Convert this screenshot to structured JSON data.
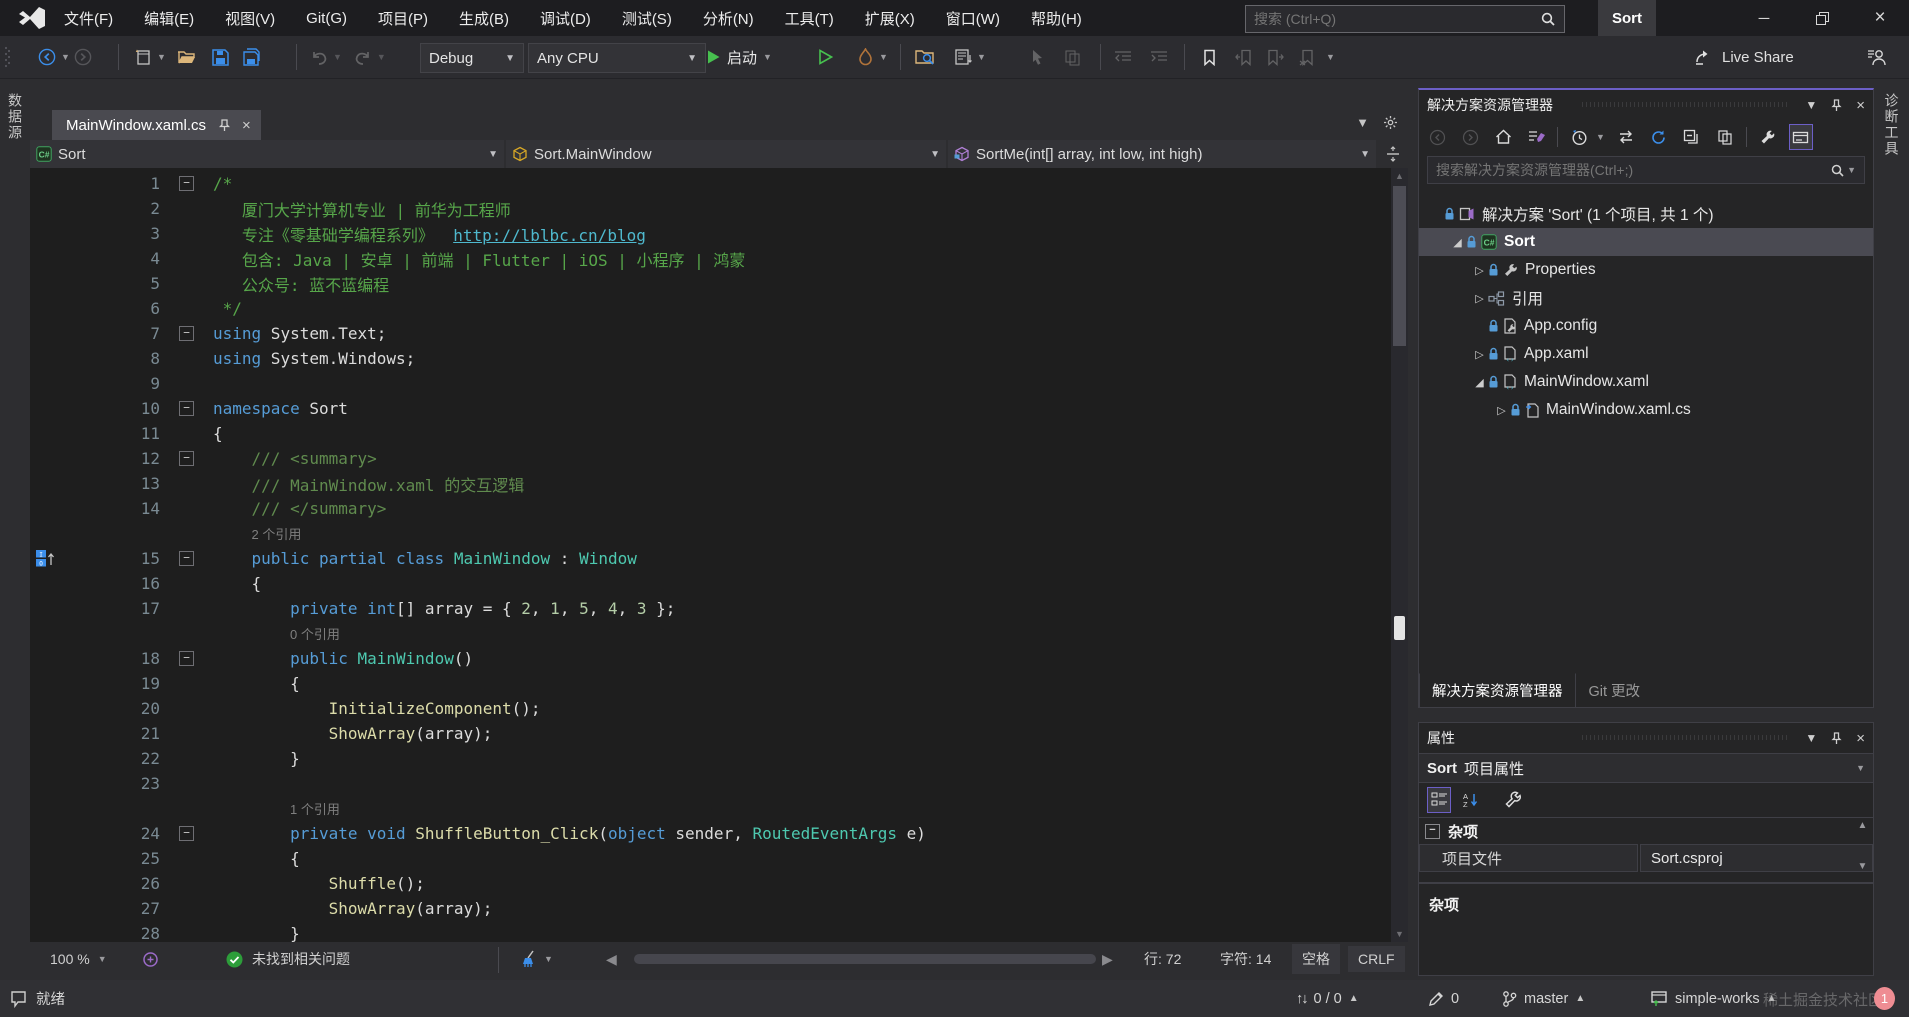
{
  "title_bar": {
    "menus": [
      "文件(F)",
      "编辑(E)",
      "视图(V)",
      "Git(G)",
      "项目(P)",
      "生成(B)",
      "调试(D)",
      "测试(S)",
      "分析(N)",
      "工具(T)",
      "扩展(X)",
      "窗口(W)",
      "帮助(H)"
    ],
    "search_placeholder": "搜索 (Ctrl+Q)",
    "window_title": "Sort"
  },
  "toolbar": {
    "config": "Debug",
    "platform": "Any CPU",
    "start_label": "启动",
    "live_share_label": "Live Share"
  },
  "side_strips": {
    "left_tab": "数据源",
    "right_tab": "诊断工具"
  },
  "editor": {
    "tab_title": "MainWindow.xaml.cs",
    "breadcrumbs": {
      "project": "Sort",
      "type": "Sort.MainWindow",
      "member": "SortMe(int[] array, int low, int high)"
    },
    "code_lines": [
      {
        "n": 1,
        "fold": true,
        "ind": 0,
        "segs": [
          [
            "cm",
            "/*"
          ]
        ]
      },
      {
        "n": 2,
        "ind": 3,
        "segs": [
          [
            "cm",
            "厦门大学计算机专业 | 前华为工程师"
          ]
        ]
      },
      {
        "n": 3,
        "ind": 3,
        "segs": [
          [
            "cm",
            "专注《零基础学编程系列》  "
          ],
          [
            "lnk",
            "http://lblbc.cn/blog"
          ]
        ]
      },
      {
        "n": 4,
        "ind": 3,
        "segs": [
          [
            "cm",
            "包含: Java | 安卓 | 前端 | Flutter | iOS | 小程序 | 鸿蒙"
          ]
        ]
      },
      {
        "n": 5,
        "ind": 3,
        "segs": [
          [
            "cm",
            "公众号: 蓝不蓝编程"
          ]
        ]
      },
      {
        "n": 6,
        "ind": 1,
        "segs": [
          [
            "cm",
            "*/"
          ]
        ]
      },
      {
        "n": 7,
        "fold": true,
        "ind": 0,
        "segs": [
          [
            "kw",
            "using"
          ],
          [
            "pl",
            " System.Text;"
          ]
        ]
      },
      {
        "n": 8,
        "ind": 0,
        "segs": [
          [
            "kw",
            "using"
          ],
          [
            "pl",
            " System.Windows;"
          ]
        ]
      },
      {
        "n": 9,
        "ind": 0,
        "segs": []
      },
      {
        "n": 10,
        "fold": true,
        "ind": 0,
        "segs": [
          [
            "kw",
            "namespace"
          ],
          [
            "pl",
            " Sort"
          ]
        ]
      },
      {
        "n": 11,
        "ind": 0,
        "segs": [
          [
            "pl",
            "{"
          ]
        ]
      },
      {
        "n": 12,
        "fold": true,
        "ind": 4,
        "segs": [
          [
            "doc",
            "/// <summary>"
          ]
        ]
      },
      {
        "n": 13,
        "ind": 4,
        "segs": [
          [
            "doc",
            "/// MainWindow.xaml 的交互逻辑"
          ]
        ]
      },
      {
        "n": 14,
        "ind": 4,
        "segs": [
          [
            "doc",
            "/// </summary>"
          ]
        ]
      },
      {
        "lens": "2 个引用",
        "ind": 4
      },
      {
        "n": 15,
        "fold": true,
        "ind": 4,
        "margin_icon": true,
        "segs": [
          [
            "kw",
            "public partial class"
          ],
          [
            "pl",
            " "
          ],
          [
            "ty",
            "MainWindow"
          ],
          [
            "pl",
            " : "
          ],
          [
            "ty",
            "Window"
          ]
        ]
      },
      {
        "n": 16,
        "ind": 4,
        "segs": [
          [
            "pl",
            "{"
          ]
        ]
      },
      {
        "n": 17,
        "ind": 8,
        "segs": [
          [
            "kw",
            "private int"
          ],
          [
            "pl",
            "[] array = { "
          ],
          [
            "nm",
            "2"
          ],
          [
            "pl",
            ", "
          ],
          [
            "nm",
            "1"
          ],
          [
            "pl",
            ", "
          ],
          [
            "nm",
            "5"
          ],
          [
            "pl",
            ", "
          ],
          [
            "nm",
            "4"
          ],
          [
            "pl",
            ", "
          ],
          [
            "nm",
            "3"
          ],
          [
            "pl",
            " };"
          ]
        ]
      },
      {
        "lens": "0 个引用",
        "ind": 8
      },
      {
        "n": 18,
        "fold": true,
        "ind": 8,
        "segs": [
          [
            "kw",
            "public "
          ],
          [
            "ty",
            "MainWindow"
          ],
          [
            "pl",
            "()"
          ]
        ]
      },
      {
        "n": 19,
        "ind": 8,
        "segs": [
          [
            "pl",
            "{"
          ]
        ]
      },
      {
        "n": 20,
        "ind": 12,
        "segs": [
          [
            "me",
            "InitializeComponent"
          ],
          [
            "pl",
            "();"
          ]
        ]
      },
      {
        "n": 21,
        "ind": 12,
        "segs": [
          [
            "me",
            "ShowArray"
          ],
          [
            "pl",
            "(array);"
          ]
        ]
      },
      {
        "n": 22,
        "ind": 8,
        "segs": [
          [
            "pl",
            "}"
          ]
        ]
      },
      {
        "n": 23,
        "ind": 0,
        "segs": []
      },
      {
        "lens": "1 个引用",
        "ind": 8
      },
      {
        "n": 24,
        "fold": true,
        "ind": 8,
        "segs": [
          [
            "kw",
            "private void "
          ],
          [
            "me",
            "ShuffleButton_Click"
          ],
          [
            "pl",
            "("
          ],
          [
            "kw",
            "object"
          ],
          [
            "pl",
            " sender, "
          ],
          [
            "ty",
            "RoutedEventArgs"
          ],
          [
            "pl",
            " e)"
          ]
        ]
      },
      {
        "n": 25,
        "ind": 8,
        "segs": [
          [
            "pl",
            "{"
          ]
        ]
      },
      {
        "n": 26,
        "ind": 12,
        "segs": [
          [
            "me",
            "Shuffle"
          ],
          [
            "pl",
            "();"
          ]
        ]
      },
      {
        "n": 27,
        "ind": 12,
        "segs": [
          [
            "me",
            "ShowArray"
          ],
          [
            "pl",
            "(array);"
          ]
        ]
      },
      {
        "n": 28,
        "ind": 8,
        "segs": [
          [
            "pl",
            "}"
          ]
        ]
      }
    ],
    "status": {
      "zoom": "100 %",
      "analysis": "未找到相关问题",
      "line": "行: 72",
      "column": "字符: 14",
      "spaces": "空格",
      "line_ending": "CRLF"
    }
  },
  "solution_explorer": {
    "title": "解决方案资源管理器",
    "search_placeholder": "搜索解决方案资源管理器(Ctrl+;)",
    "tree": [
      {
        "label": "解决方案 'Sort' (1 个项目, 共 1 个)",
        "indent": 0,
        "expander": "",
        "icons": [
          "lock",
          "solution"
        ],
        "selected": false
      },
      {
        "label": "Sort",
        "indent": 1,
        "expander": "expanded",
        "icons": [
          "lock",
          "csharp"
        ],
        "selected": true
      },
      {
        "label": "Properties",
        "indent": 2,
        "expander": "collapsed",
        "icons": [
          "lock",
          "wrench"
        ],
        "selected": false
      },
      {
        "label": "引用",
        "indent": 2,
        "expander": "collapsed",
        "icons": [
          "refs"
        ],
        "selected": false
      },
      {
        "label": "App.config",
        "indent": 2,
        "expander": "",
        "icons": [
          "lock",
          "doc-config"
        ],
        "selected": false
      },
      {
        "label": "App.xaml",
        "indent": 2,
        "expander": "collapsed",
        "icons": [
          "lock",
          "doc-xaml"
        ],
        "selected": false
      },
      {
        "label": "MainWindow.xaml",
        "indent": 2,
        "expander": "expanded",
        "icons": [
          "lock",
          "doc-xaml"
        ],
        "selected": false
      },
      {
        "label": "MainWindow.xaml.cs",
        "indent": 3,
        "expander": "collapsed",
        "icons": [
          "lock",
          "doc-cs"
        ],
        "selected": false
      }
    ],
    "bottom_tabs": [
      {
        "label": "解决方案资源管理器",
        "active": true
      },
      {
        "label": "Git 更改",
        "active": false
      }
    ]
  },
  "properties_panel": {
    "title": "属性",
    "object_bold": "Sort",
    "object_rest": "项目属性",
    "category": "杂项",
    "rows": [
      {
        "name": "项目文件",
        "value": "Sort.csproj"
      }
    ],
    "description_title": "杂项"
  },
  "status_bar": {
    "ready": "就绪",
    "sync_counts": "0 / 0",
    "pending_edits": "0",
    "branch": "master",
    "repo": "simple-works",
    "watermark": "稀土掘金技术社区",
    "badge": "1"
  }
}
